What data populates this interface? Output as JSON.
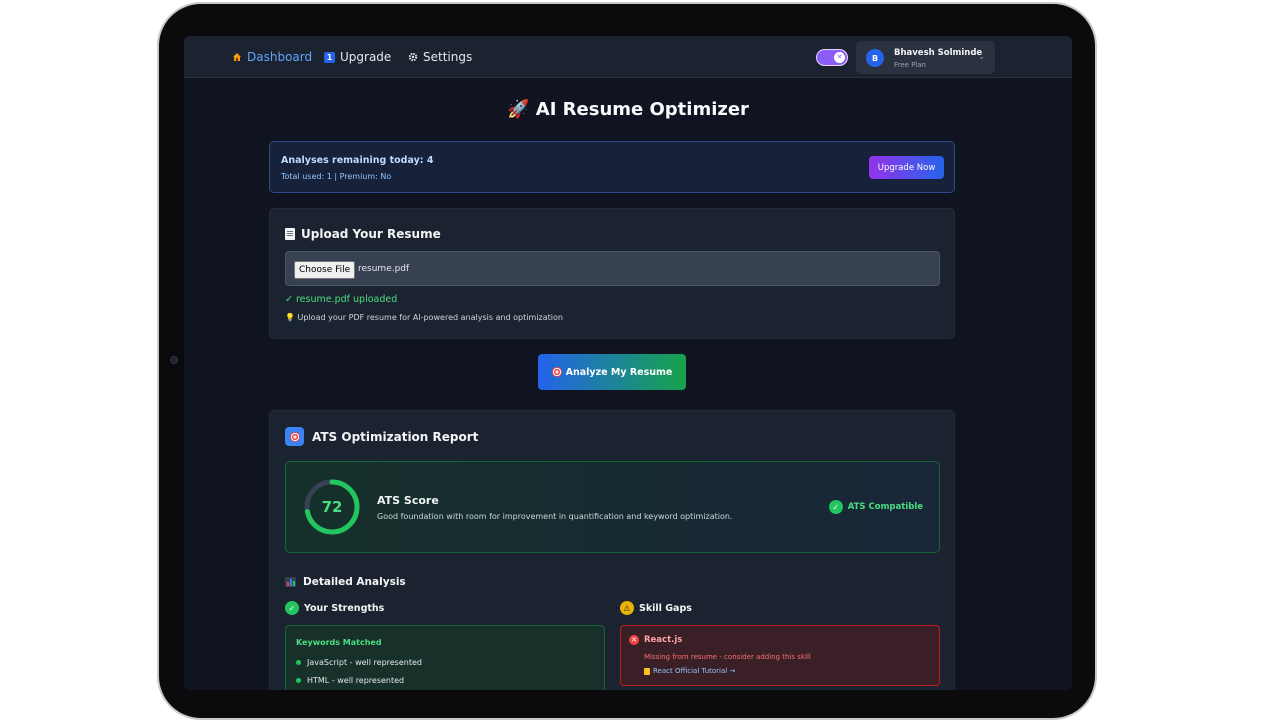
{
  "nav": {
    "items": [
      {
        "label": "Dashboard",
        "icon": "home-icon",
        "active": true
      },
      {
        "label": "Upgrade",
        "icon": "upgrade-icon"
      },
      {
        "label": "Settings",
        "icon": "gear-icon"
      }
    ],
    "theme_toggle": {
      "state": "on",
      "color": "#8b5cf6"
    },
    "user": {
      "initial": "B",
      "name": "Bhavesh Solminde",
      "plan": "Free Plan"
    }
  },
  "page": {
    "title": "AI Resume Optimizer",
    "title_icon": "🚀"
  },
  "quota": {
    "remaining": "Analyses remaining today: 4",
    "details": "Total used: 1 | Premium: No",
    "upgrade_label": "Upgrade Now"
  },
  "upload": {
    "heading": "Upload Your Resume",
    "choose_label": "Choose File",
    "file_name": "resume.pdf",
    "status": "✓ resume.pdf uploaded",
    "hint_icon": "💡",
    "hint": "Upload your PDF resume for AI-powered analysis and optimization"
  },
  "analyze_label": "Analyze My Resume",
  "report": {
    "heading": "ATS Optimization Report",
    "score": {
      "value": "72",
      "percent": 72,
      "title": "ATS Score",
      "description": "Good foundation with room for improvement in quantification and keyword optimization.",
      "badge": "ATS Compatible"
    },
    "detailed_heading": "Detailed Analysis",
    "strengths": {
      "heading": "Your Strengths",
      "box_title": "Keywords Matched",
      "items": [
        "JavaScript - well represented",
        "HTML - well represented"
      ]
    },
    "gaps": {
      "heading": "Skill Gaps",
      "items": [
        {
          "skill": "React.js",
          "description": "Missing from resume - consider adding this skill",
          "link": "React Official Tutorial →"
        }
      ]
    }
  },
  "colors": {
    "accent": "#2563eb",
    "success": "#22c55e",
    "danger": "#ef4444",
    "warning": "#eab308"
  }
}
